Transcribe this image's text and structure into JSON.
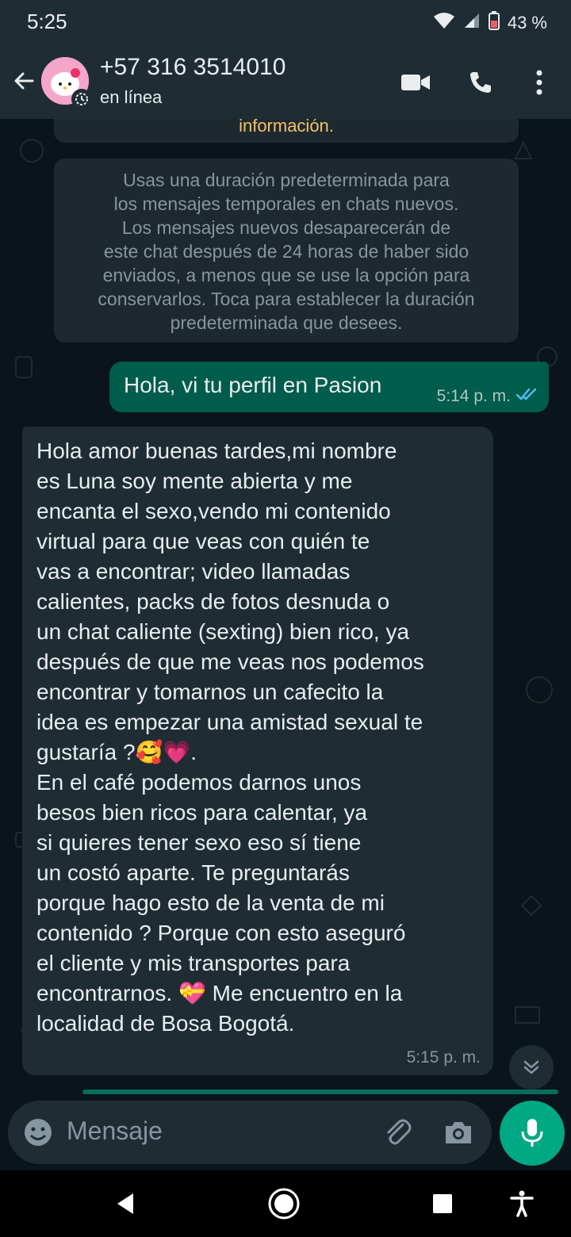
{
  "status_bar": {
    "time": "5:25",
    "battery": "43 %",
    "icons": [
      "wifi-icon",
      "signal-icon",
      "battery-icon"
    ]
  },
  "header": {
    "contact_name": "+57 316 3514010",
    "status": "en línea",
    "icons": [
      "back-arrow-icon",
      "video-call-icon",
      "phone-icon",
      "more-options-icon"
    ]
  },
  "chat": {
    "system_top_partial": "información.",
    "system_notice": "Usas una duración predeterminada para\nlos mensajes temporales en chats nuevos.\nLos mensajes nuevos desaparecerán de\neste chat después de 24 horas de haber sido\nenviados, a menos que se use la opción para\nconservarlos. Toca para establecer la duración\npredeterminada que desees.",
    "messages": [
      {
        "direction": "outgoing",
        "text": "Hola, vi tu perfil en Pasion",
        "time": "5:14 p. m.",
        "status": "read"
      },
      {
        "direction": "incoming",
        "text": "Hola amor buenas tardes,mi nombre\nes Luna soy mente abierta y me\nencanta el sexo,vendo mi contenido\nvirtual para que veas con quién te\nvas a encontrar; video llamadas\ncalientes, packs de fotos desnuda o\nun chat caliente (sexting) bien rico, ya\ndespués de que me veas nos podemos\nencontrar y tomarnos un cafecito la\nidea es empezar una amistad sexual te\ngustaría ?🥰💗.\nEn el café podemos darnos unos\nbesos bien ricos para calentar, ya\nsi quieres tener sexo eso sí tiene\nun costó aparte. Te preguntarás\nporque hago esto de la venta de mi\ncontenido ? Porque con esto aseguró\nel cliente y mis transportes para\nencontrarnos. 💝 Me encuentro en la\nlocalidad de Bosa Bogotá.",
        "time": "5:15 p. m."
      }
    ]
  },
  "composer": {
    "placeholder": "Mensaje",
    "icons": [
      "emoji-icon",
      "attach-icon",
      "camera-icon",
      "mic-icon"
    ]
  },
  "colors": {
    "app_bar": "#1f2c34",
    "background": "#0b141a",
    "outgoing_bubble": "#005c4b",
    "incoming_bubble": "#1f2c34",
    "accent": "#00a884",
    "read_ticks": "#53bdeb"
  }
}
